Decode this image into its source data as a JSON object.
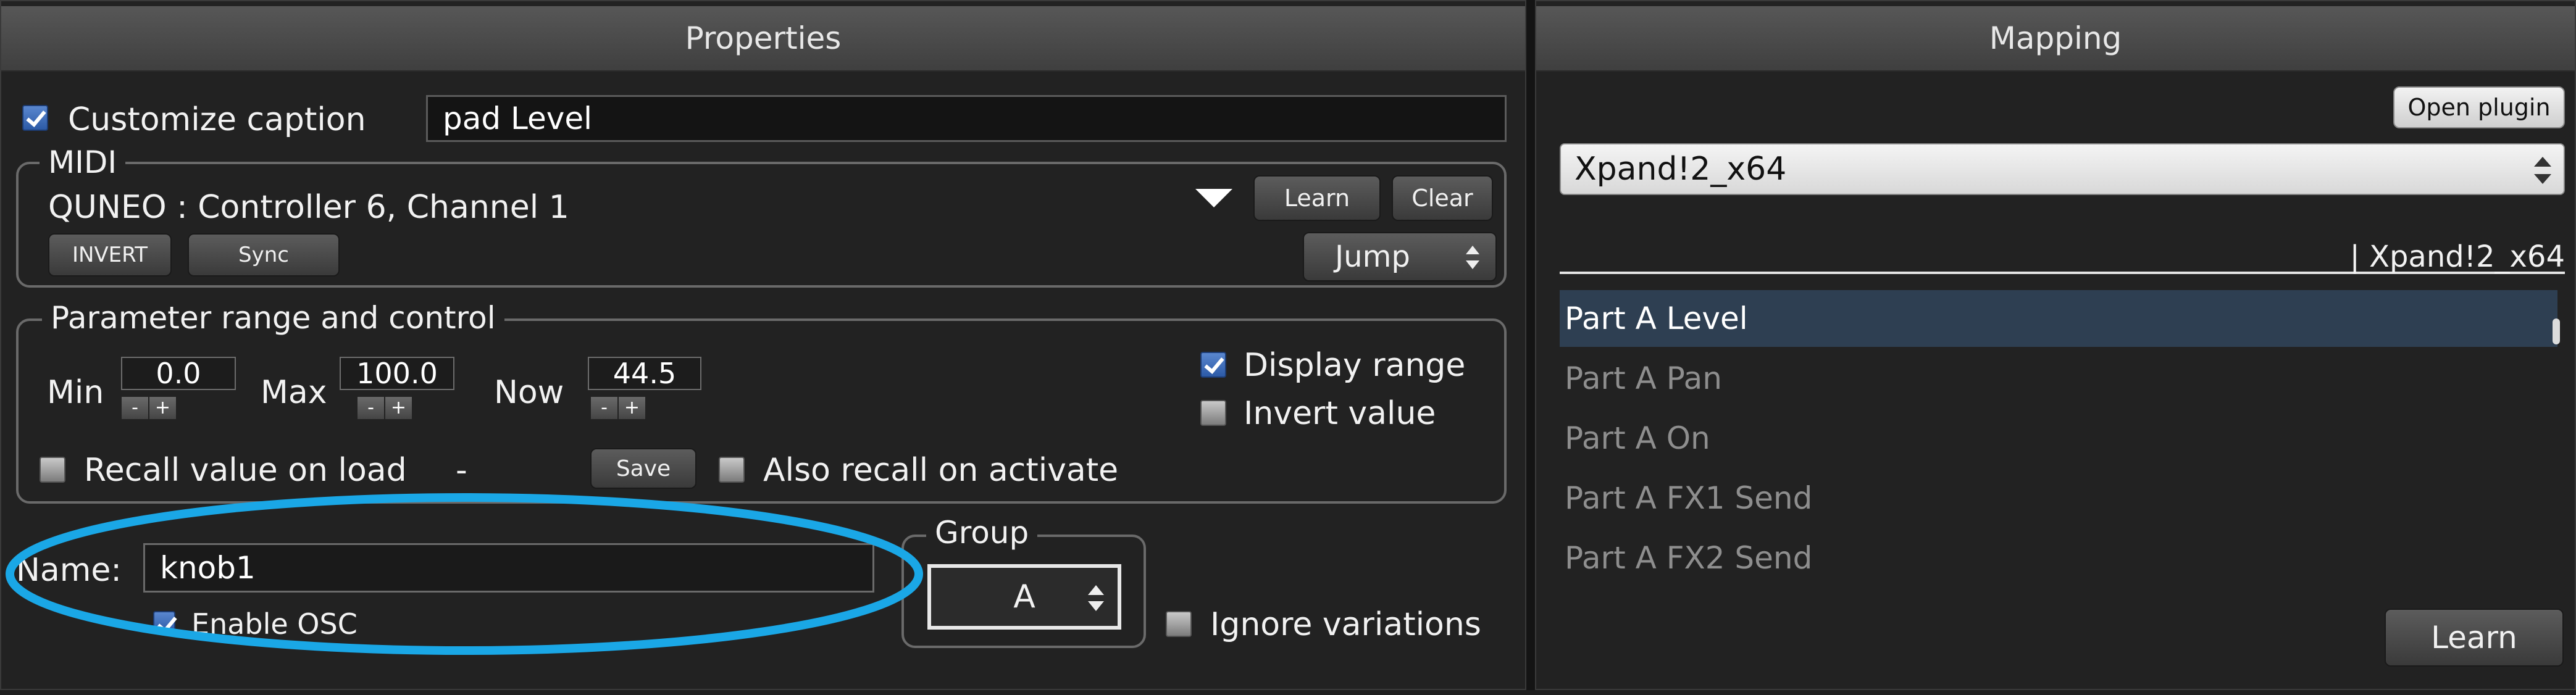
{
  "properties": {
    "title": "Properties",
    "customize_caption_label": "Customize caption",
    "customize_caption_checked": true,
    "caption_value": "pad Level",
    "midi": {
      "legend": "MIDI",
      "source": "QUNEO : Controller 6, Channel 1",
      "learn_label": "Learn",
      "clear_label": "Clear",
      "invert_label": "INVERT",
      "sync_label": "Sync",
      "mode_value": "Jump"
    },
    "range": {
      "legend": "Parameter range and control",
      "min_label": "Min",
      "min_value": "0.0",
      "max_label": "Max",
      "max_value": "100.0",
      "now_label": "Now",
      "now_value": "44.5",
      "minus": "-",
      "plus": "+",
      "display_range_label": "Display range",
      "display_range_checked": true,
      "invert_value_label": "Invert value",
      "invert_value_checked": false,
      "recall_label": "Recall value on load",
      "recall_checked": false,
      "recall_value": "-",
      "save_label": "Save",
      "also_recall_label": "Also recall on activate",
      "also_recall_checked": false
    },
    "name_label": "Name:",
    "name_value": "knob1",
    "enable_osc_label": "Enable OSC",
    "enable_osc_checked": true,
    "group_legend": "Group",
    "group_value": "A",
    "ignore_variations_label": "Ignore variations",
    "ignore_variations_checked": false
  },
  "mapping": {
    "title": "Mapping",
    "open_plugin_label": "Open plugin",
    "plugin_value": "Xpand!2_x64",
    "column_header": "| Xpand!2_x64",
    "parameters": [
      "Part A Level",
      "Part A Pan",
      "Part A On",
      "Part A FX1 Send",
      "Part A FX2 Send"
    ],
    "selected_index": 0,
    "learn_label": "Learn"
  },
  "annotation": {
    "color": "#1aa7e6"
  }
}
